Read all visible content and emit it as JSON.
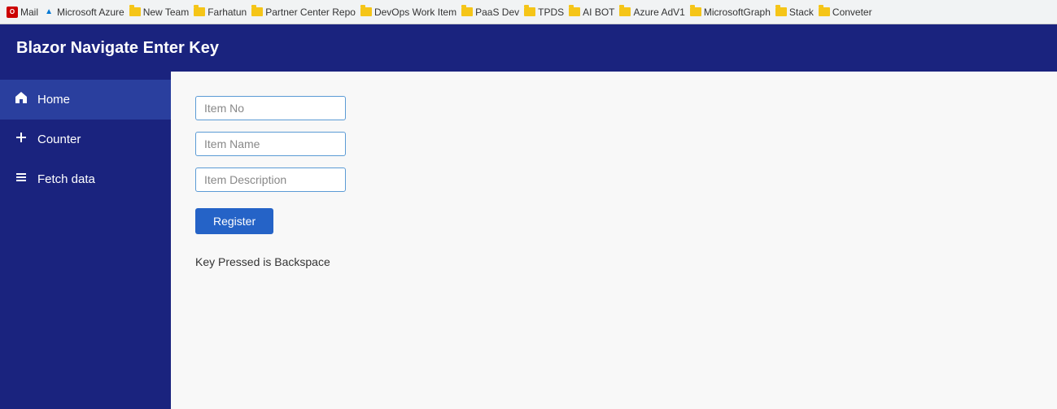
{
  "browser": {
    "bookmarks": [
      {
        "id": "mail",
        "label": "Mail",
        "type": "favicon-mail"
      },
      {
        "id": "azure",
        "label": "Microsoft Azure",
        "type": "favicon-azure"
      },
      {
        "id": "new-team",
        "label": "New Team",
        "type": "folder"
      },
      {
        "id": "farhatun",
        "label": "Farhatun",
        "type": "folder"
      },
      {
        "id": "partner-center",
        "label": "Partner Center Repo",
        "type": "folder"
      },
      {
        "id": "devops",
        "label": "DevOps Work Item",
        "type": "folder"
      },
      {
        "id": "paas-dev",
        "label": "PaaS Dev",
        "type": "folder"
      },
      {
        "id": "tpds",
        "label": "TPDS",
        "type": "folder"
      },
      {
        "id": "ai-bot",
        "label": "AI BOT",
        "type": "folder"
      },
      {
        "id": "azure-adv1",
        "label": "Azure AdV1",
        "type": "folder"
      },
      {
        "id": "microsoft-graph",
        "label": "MicrosoftGraph",
        "type": "folder"
      },
      {
        "id": "stack",
        "label": "Stack",
        "type": "folder"
      },
      {
        "id": "conveter",
        "label": "Conveter",
        "type": "folder"
      }
    ]
  },
  "app": {
    "title": "Blazor Navigate Enter Key"
  },
  "sidebar": {
    "items": [
      {
        "id": "home",
        "label": "Home",
        "icon": "house",
        "active": true
      },
      {
        "id": "counter",
        "label": "Counter",
        "icon": "plus",
        "active": false
      },
      {
        "id": "fetch-data",
        "label": "Fetch data",
        "icon": "list",
        "active": false
      }
    ]
  },
  "form": {
    "item_no_placeholder": "Item No",
    "item_name_placeholder": "Item Name",
    "item_description_placeholder": "Item Description",
    "register_label": "Register",
    "key_status": "Key Pressed is Backspace"
  }
}
